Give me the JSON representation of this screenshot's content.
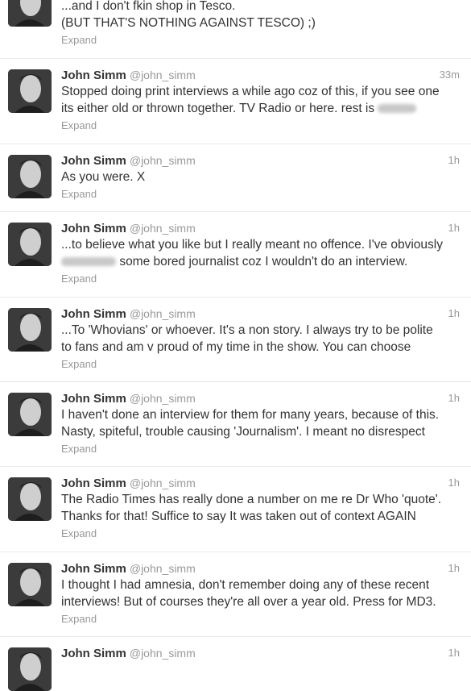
{
  "first_tweet": {
    "lines": [
      "...and I don't fkin shop in Tesco.",
      "(BUT THAT'S NOTHING AGAINST TESCO) ;)"
    ],
    "expand": "Expand"
  },
  "tweets": [
    {
      "name": "John Simm",
      "handle": "@john_simm",
      "time": "33m",
      "line1": "Stopped doing print interviews a while ago coz of this, if you see one",
      "line2": "its either old or thrown together. TV Radio or here. rest is",
      "expand": "Expand"
    },
    {
      "name": "John Simm",
      "handle": "@john_simm",
      "time": "1h",
      "line1": "As you were. X",
      "expand": "Expand"
    },
    {
      "name": "John Simm",
      "handle": "@john_simm",
      "time": "1h",
      "line1": "...to believe what you like but I really meant no offence. I've obviously",
      "line2": "some bored journalist coz I wouldn't do an interview.",
      "expand": "Expand"
    },
    {
      "name": "John Simm",
      "handle": "@john_simm",
      "time": "1h",
      "line1": "...To 'Whovians' or whoever. It's a non story. I always try to be polite",
      "line2": "to fans and am v proud of my time in the show. You can choose",
      "expand": "Expand"
    },
    {
      "name": "John Simm",
      "handle": "@john_simm",
      "time": "1h",
      "line1": "I haven't done an interview for them for many years, because of this.",
      "line2": "Nasty, spiteful, trouble causing 'Journalism'. I meant no disrespect",
      "expand": "Expand"
    },
    {
      "name": "John Simm",
      "handle": "@john_simm",
      "time": "1h",
      "line1": "The Radio Times has really done a number on me re Dr Who 'quote'.",
      "line2": "Thanks for that! Suffice to say It was taken out of context AGAIN",
      "expand": "Expand"
    },
    {
      "name": "John Simm",
      "handle": "@john_simm",
      "time": "1h",
      "line1": "I thought I had amnesia, don't remember doing any of these recent",
      "line2": "interviews! But of courses they're all over a year old. Press for MD3.",
      "expand": "Expand"
    },
    {
      "name": "John Simm",
      "handle": "@john_simm",
      "time": "1h"
    }
  ]
}
